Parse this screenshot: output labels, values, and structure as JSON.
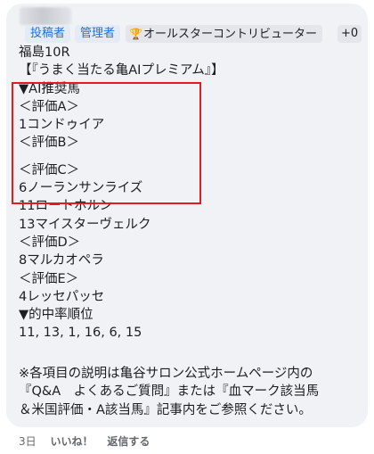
{
  "comment": {
    "badges": {
      "poster": "投稿者",
      "admin": "管理者",
      "contributor": "オールスターコントリビューター",
      "more": "+0"
    },
    "icons": {
      "contributor": "trophy-icon"
    },
    "lines": [
      "福島10R",
      "【『うまく当たる亀AIプレミアム』】",
      "▼AI推奨馬",
      "＜評価A＞",
      "1コンドゥイア",
      "＜評価B＞",
      "",
      "＜評価C＞",
      "6ノーランサンライズ",
      "11ロートホルン",
      "13マイスターヴェルク",
      "＜評価D＞",
      "8マルカオペラ",
      "＜評価E＞",
      "4レッセパッセ",
      "▼的中率順位",
      "11, 13, 1, 16, 6, 15"
    ],
    "note_lines": [
      "※各項目の説明は亀谷サロン公式ホームページ内の",
      "『Q&A　よくあるご質問』または『血マーク該当馬",
      "＆米国評価・A該当馬』記事内をご参照ください。"
    ]
  },
  "actions": {
    "time": "3日",
    "like": "いいね！",
    "reply": "返信する"
  },
  "colors": {
    "bubble": "#f0f2f5",
    "badge_blue": "#216fdb",
    "highlight": "#e41b1b"
  }
}
